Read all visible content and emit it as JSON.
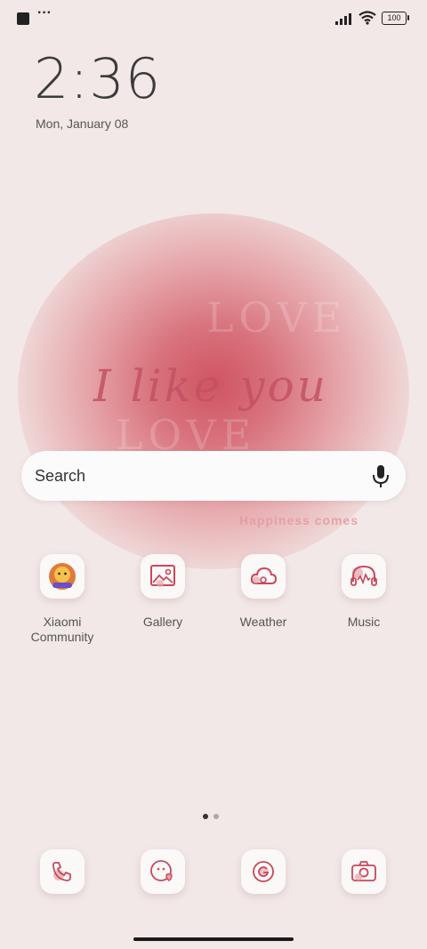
{
  "status": {
    "battery": "100"
  },
  "clock": {
    "time": "2:36",
    "date": "Mon, January 08"
  },
  "wallpaper": {
    "script": "I like you",
    "word": "LOVE",
    "tagline": "Happiness comes"
  },
  "search": {
    "label": "Search"
  },
  "apps": [
    {
      "label": "Xiaomi Community",
      "icon": "xiaomi-community-icon"
    },
    {
      "label": "Gallery",
      "icon": "gallery-icon"
    },
    {
      "label": "Weather",
      "icon": "weather-icon"
    },
    {
      "label": "Music",
      "icon": "music-icon"
    }
  ],
  "page_indicator": {
    "pages": 2,
    "current": 1
  },
  "dock": [
    {
      "icon": "phone-icon"
    },
    {
      "icon": "messages-icon"
    },
    {
      "icon": "browser-icon"
    },
    {
      "icon": "camera-icon"
    }
  ],
  "colors": {
    "accent": "#c9475a",
    "background": "#f1e8e7"
  }
}
